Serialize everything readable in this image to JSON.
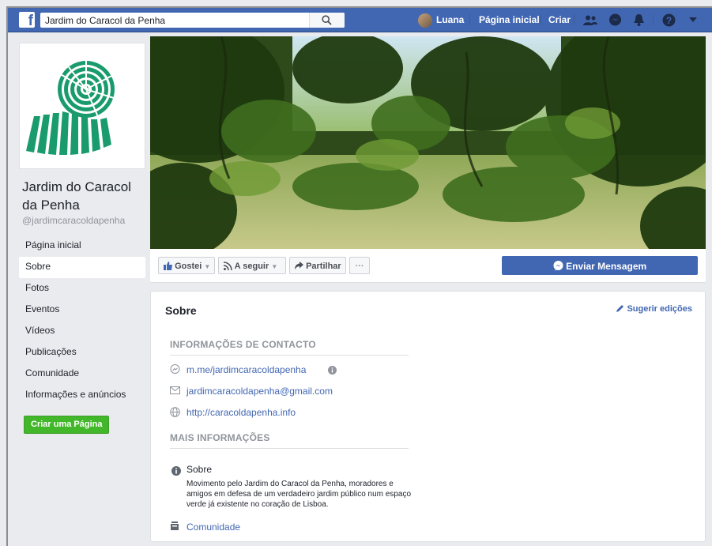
{
  "topbar": {
    "search_value": "Jardim do Caracol da Penha",
    "user_name": "Luana",
    "home_label": "Página inicial",
    "create_label": "Criar",
    "logo_letter": "f"
  },
  "page": {
    "name": "Jardim do Caracol da Penha",
    "handle": "@jardimcaracoldapenha"
  },
  "sidebar": {
    "items": [
      {
        "label": "Página inicial"
      },
      {
        "label": "Sobre"
      },
      {
        "label": "Fotos"
      },
      {
        "label": "Eventos"
      },
      {
        "label": "Vídeos"
      },
      {
        "label": "Publicações"
      },
      {
        "label": "Comunidade"
      },
      {
        "label": "Informações e anúncios"
      }
    ],
    "active_index": 1,
    "create_page_label": "Criar uma Página"
  },
  "actions": {
    "like_label": "Gostei",
    "follow_label": "A seguir",
    "share_label": "Partilhar",
    "more_label": "···",
    "message_label": "Enviar Mensagem"
  },
  "about": {
    "title": "Sobre",
    "suggest_label": "Sugerir edições",
    "contact_heading": "INFORMAÇÕES DE CONTACTO",
    "messenger_link": "m.me/jardimcaracoldapenha",
    "email": "jardimcaracoldapenha@gmail.com",
    "website": "http://caracoldapenha.info",
    "more_heading": "MAIS INFORMAÇÕES",
    "about_label": "Sobre",
    "about_text": "Movimento pelo Jardim do Caracol da Penha, moradores e amigos em defesa de um verdadeiro jardim público num espaço verde já existente no coração de Lisboa.",
    "community_label": "Comunidade"
  },
  "colors": {
    "brand_blue": "#4267b2",
    "create_green": "#42b72a",
    "logo_green": "#1a9b6e"
  },
  "icons": [
    "facebook-logo-icon",
    "search-icon",
    "friends-icon",
    "messenger-icon",
    "notifications-icon",
    "help-icon",
    "caret-down-icon",
    "like-icon",
    "rss-icon",
    "share-icon",
    "messenger-icon",
    "pencil-icon",
    "envelope-icon",
    "globe-icon",
    "info-icon",
    "community-icon"
  ]
}
